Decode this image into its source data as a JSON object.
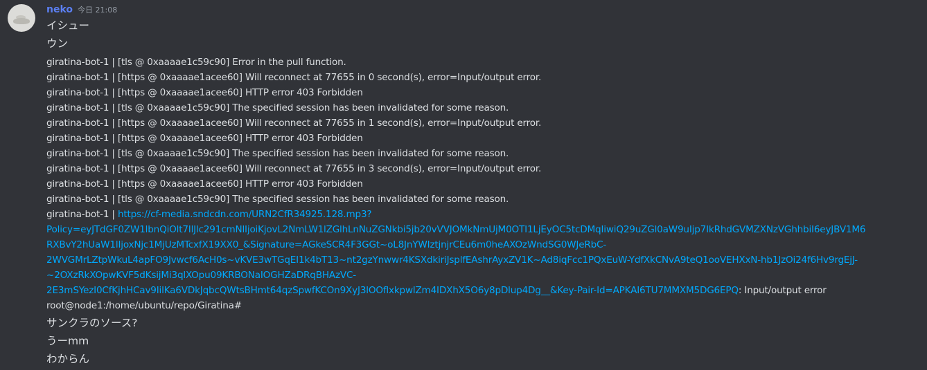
{
  "message": {
    "author": "neko",
    "timestamp": "今日 21:08",
    "lines_top": [
      "イシュー",
      "ウン"
    ],
    "log_lines": [
      "giratina-bot-1  | [tls @ 0xaaaae1c59c90] Error in the pull function.",
      "giratina-bot-1  | [https @ 0xaaaae1acee60] Will reconnect at 77655 in 0 second(s), error=Input/output error.",
      "giratina-bot-1  | [https @ 0xaaaae1acee60] HTTP error 403 Forbidden",
      "giratina-bot-1  | [tls @ 0xaaaae1c59c90] The specified session has been invalidated for some reason.",
      "giratina-bot-1  | [https @ 0xaaaae1acee60] Will reconnect at 77655 in 1 second(s), error=Input/output error.",
      "giratina-bot-1  | [https @ 0xaaaae1acee60] HTTP error 403 Forbidden",
      "giratina-bot-1  | [tls @ 0xaaaae1c59c90] The specified session has been invalidated for some reason.",
      "giratina-bot-1  | [https @ 0xaaaae1acee60] Will reconnect at 77655 in 3 second(s), error=Input/output error.",
      "giratina-bot-1  | [https @ 0xaaaae1acee60] HTTP error 403 Forbidden",
      "giratina-bot-1  | [tls @ 0xaaaae1c59c90] The specified session has been invalidated for some reason."
    ],
    "link_prefix": "giratina-bot-1  | ",
    "link_parts": [
      "https://cf-media.sndcdn.com/URN2CfR34925.128.mp3?",
      "Policy=eyJTdGF0ZW1lbnQiOlt7IlJlc291cmNlIjoiKjovL2NmLW1lZGlhLnNuZGNkbi5jb20vVVJOMkNmUjM0OTI1LjEyOC5tcDMqIiwiQ29uZGl0aW9uIjp7IkRhdGVMZXNzVGhhbiI6eyJBV1M6",
      "RXBvY2hUaW1lIjoxNjc1MjUzMTcxfX19XX0_&Signature=AGkeSCR4F3GGt~oL8JnYWIztjnjrCEu6m0heAXOzWndSG0WJeRbC-",
      "2WVGMrLZtpWkuL4apFO9Jvwcf6AcH0s~vKVE3wTGqEI1k4bT13~nt2gzYnwwr4KSXdkiriJsplfEAshrAyxZV1K~Ad8iqFcc1PQxEuW-YdfXkCNvA9teQ1ooVEHXxN-hb1JzOi24f6Hv9rgEjJ-",
      "~2OXzRkXOpwKVF5dKsijMi3qlXOpu09KRBONaIOGHZaDRqBHAzVC-",
      "2E3mSYezI0CfKjhHCav9IilKa6VDkJqbcQWtsBHmt64qzSpwfKCOn9XyJ3lOOflxkpwlZm4IDXhX5O6y8pDlup4Dg__&Key-Pair-Id=APKAI6TU7MMXM5DG6EPQ"
    ],
    "link_suffix": ": Input/output error",
    "prompt_line": "root@node1:/home/ubuntu/repo/Giratina#",
    "lines_bottom": [
      "サンクラのソース?",
      "うーmm",
      "わからん"
    ]
  }
}
